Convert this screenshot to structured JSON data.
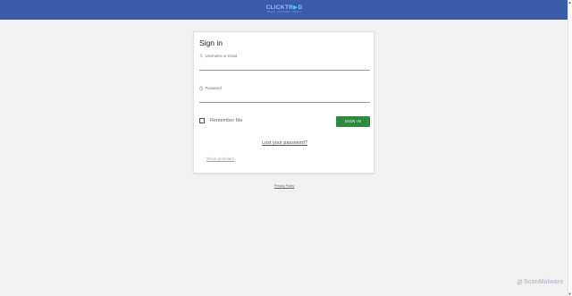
{
  "header": {
    "logo_text": "CLICKTR",
    "logo_play": "▶",
    "logo_tail": "D",
    "logo_tagline": "TRACK • OPTIMIZE • PROFIT",
    "background_color": "#3a5ba9"
  },
  "login": {
    "title": "Sign in",
    "username_label": "Username or Email",
    "username_value": "",
    "password_label": "Password",
    "password_value": "",
    "remember_label": "Remember Me",
    "remember_checked": false,
    "signin_label": "SIGN IN",
    "signin_color": "#2e8a3e",
    "lost_password": "Lost your password?",
    "show_providers": "Show providers"
  },
  "footer": {
    "privacy": "Privacy Policy"
  },
  "watermark": {
    "text": "ScanMalware"
  }
}
